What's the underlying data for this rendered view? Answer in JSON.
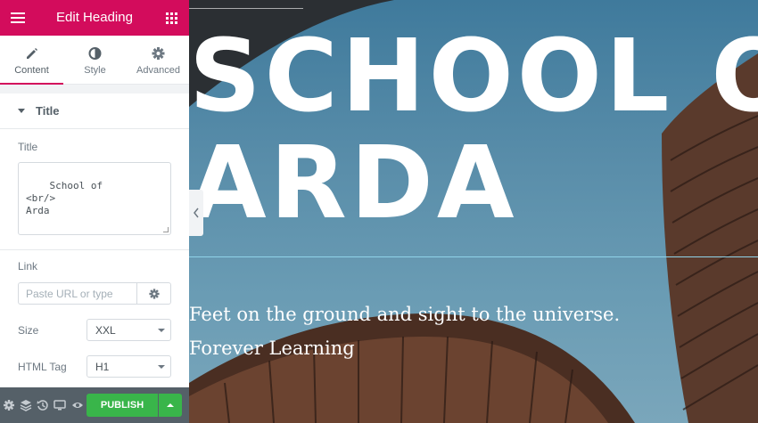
{
  "panel": {
    "title": "Edit Heading",
    "tabs": [
      {
        "label": "Content",
        "icon": "pencil-icon"
      },
      {
        "label": "Style",
        "icon": "contrast-icon"
      },
      {
        "label": "Advanced",
        "icon": "gear-icon"
      }
    ],
    "section_title": "Title",
    "title_field": {
      "label": "Title",
      "value": "School of\n<br/>\nArda"
    },
    "link_field": {
      "label": "Link",
      "placeholder": "Paste URL or type"
    },
    "size_field": {
      "label": "Size",
      "value": "XXL"
    },
    "html_tag_field": {
      "label": "HTML Tag",
      "value": "H1"
    },
    "footer": {
      "icons": [
        "settings-icon",
        "layers-icon",
        "history-icon",
        "responsive-icon",
        "preview-icon"
      ],
      "publish_label": "PUBLISH"
    }
  },
  "preview": {
    "heading_line1": "SCHOOL OF",
    "heading_line2": "ARDA",
    "subheading": "Feet on the ground and sight to the universe. Forever Learning"
  },
  "colors": {
    "accent": "#d30c5c",
    "publish": "#39b54a",
    "footer": "#556068"
  }
}
